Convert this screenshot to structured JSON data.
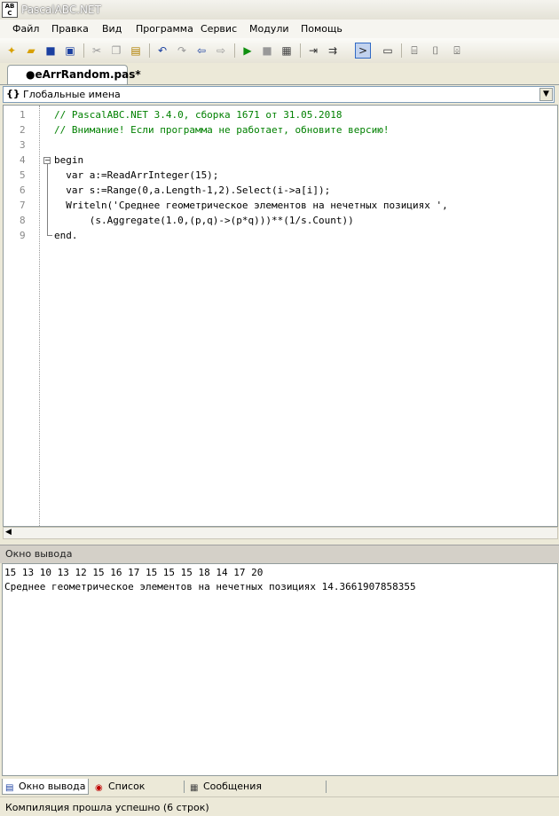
{
  "window": {
    "title": "PascalABC.NET"
  },
  "menu": [
    "Файл",
    "Правка",
    "Вид",
    "Программа",
    "Сервис",
    "Модули",
    "Помощь"
  ],
  "tab": {
    "label": "●eArrRandom.pas*"
  },
  "scope_combo": {
    "value": "Глобальные имена"
  },
  "editor": {
    "line_numbers": [
      "1",
      "2",
      "3",
      "4",
      "5",
      "6",
      "7",
      "8",
      "9"
    ],
    "lines": [
      "// PascalABC.NET 3.4.0, сборка 1671 от 31.05.2018",
      "// Внимание! Если программа не работает, обновите версию!",
      "",
      "begin",
      "  var a:=ReadArrInteger(15);",
      "  var s:=Range(0,a.Length-1,2).Select(i->a[i]);",
      "  Writeln('Среднее геометрическое элементов на нечетных позициях ',",
      "      (s.Aggregate(1.0,(p,q)->(p*q)))**(1/s.Count))",
      "end."
    ]
  },
  "output_panel": {
    "title": "Окно вывода",
    "lines": [
      "15 13 10 13 12 15 16 17 15 15 15 18 14 17 20",
      "Среднее геометрическое элементов на нечетных позициях 14.3661907858355"
    ]
  },
  "bottom_tabs": [
    "Окно вывода",
    "Список ошибок",
    "Сообщения компилятора"
  ],
  "status": "Компиляция прошла успешно (6 строк)"
}
